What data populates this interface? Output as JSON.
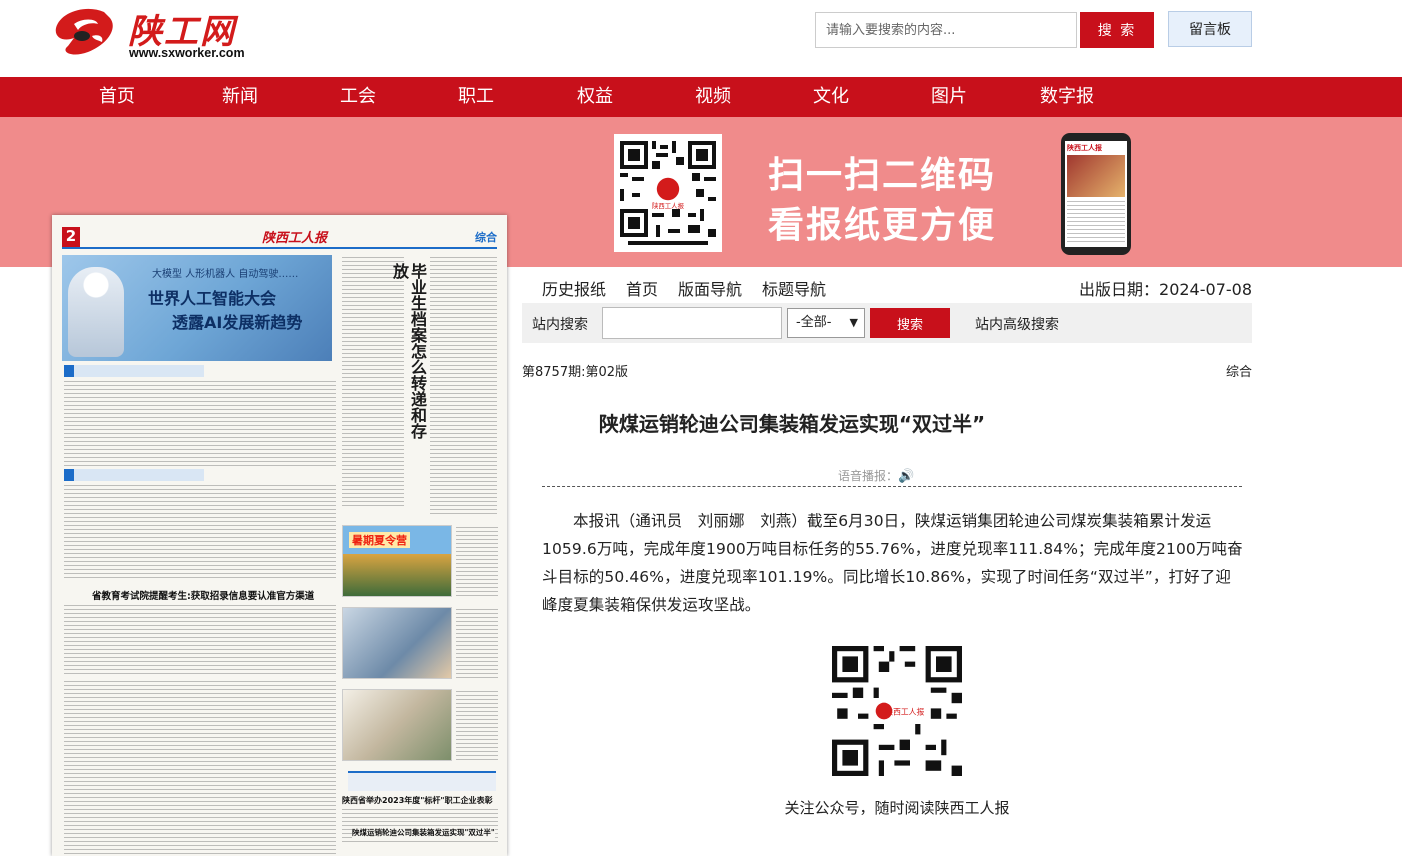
{
  "header": {
    "logo_text": "陕工网",
    "logo_url": "www.sxworker.com",
    "search_placeholder": "请输入要搜索的内容...",
    "search_button": "搜 索",
    "message_board": "留言板"
  },
  "nav": {
    "items": [
      "首页",
      "新闻",
      "工会",
      "职工",
      "权益",
      "视频",
      "文化",
      "图片",
      "数字报"
    ]
  },
  "banner": {
    "line1": "扫一扫二维码",
    "line2": "看报纸更方便",
    "qr_caption": "陕西工人报"
  },
  "paper": {
    "page_no": "2",
    "name": "陕西工人报",
    "column": "综合",
    "hero_subtitle": "大模型 人形机器人 自动驾驶……",
    "hero_title1": "世界人工智能大会",
    "hero_title2": "透露AI发展新趋势",
    "vertical_title": "毕业生档案怎么转递和存放",
    "headline1": "省教育考试院提醒考生:获取招录信息要认准官方渠道",
    "headline2": "陕西省举办2023年度\"标杆\"职工企业表彰",
    "headline3": "陕煤运销轮迪公司集装箱发运实现\"双过半\"",
    "photo_banner": "暑期夏令营"
  },
  "toolbar": {
    "links": [
      "历史报纸",
      "首页",
      "版面导航",
      "标题导航"
    ],
    "pub_date_label": "出版日期：",
    "pub_date": "2024-07-08"
  },
  "site_search": {
    "label": "站内搜索",
    "select": "-全部-",
    "button": "搜索",
    "advanced": "站内高级搜索"
  },
  "article": {
    "issue": "第8757期:第02版",
    "section": "综合",
    "title": "陕煤运销轮迪公司集装箱发运实现“双过半”",
    "voice": "语音播报：",
    "body": "本报讯（通讯员　刘丽娜　刘燕）截至6月30日，陕煤运销集团轮迪公司煤炭集装箱累计发运1059.6万吨，完成年度1900万吨目标任务的55.76%，进度兑现率111.84%；完成年度2100万吨奋斗目标的50.46%，进度兑现率101.19%。同比增长10.86%，实现了时间任务“双过半”，打好了迎峰度夏集装箱保供发运攻坚战。",
    "qr_caption": "关注公众号，随时阅读陕西工人报"
  },
  "colors": {
    "brand_red": "#c8101b",
    "banner_pink": "#f08b8b",
    "paper_blue": "#1c6cc8"
  }
}
